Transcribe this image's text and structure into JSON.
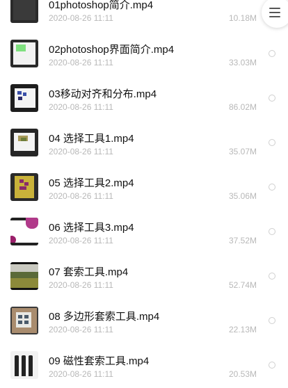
{
  "files": [
    {
      "name": "01photoshop简介.mp4",
      "date": "2020-08-26 11:11",
      "size": "10.18M",
      "icon": "video-thumbnail-dark"
    },
    {
      "name": "02photoshop界面简介.mp4",
      "date": "2020-08-26 11:11",
      "size": "33.03M",
      "icon": "video-thumbnail-interface"
    },
    {
      "name": "03移动对齐和分布.mp4",
      "date": "2020-08-26 11:11",
      "size": "86.02M",
      "icon": "video-thumbnail-align"
    },
    {
      "name": "04 选择工具1.mp4",
      "date": "2020-08-26 11:11",
      "size": "35.07M",
      "icon": "video-thumbnail-select1"
    },
    {
      "name": "05 选择工具2.mp4",
      "date": "2020-08-26 11:11",
      "size": "35.06M",
      "icon": "video-thumbnail-select2"
    },
    {
      "name": "06 选择工具3.mp4",
      "date": "2020-08-26 11:11",
      "size": "37.52M",
      "icon": "video-thumbnail-select3"
    },
    {
      "name": "07 套索工具.mp4",
      "date": "2020-08-26 11:11",
      "size": "52.74M",
      "icon": "video-thumbnail-landscape"
    },
    {
      "name": "08 多边形套索工具.mp4",
      "date": "2020-08-26 11:11",
      "size": "22.13M",
      "icon": "video-thumbnail-building"
    },
    {
      "name": "09 磁性套索工具.mp4",
      "date": "2020-08-26 11:11",
      "size": "20.53M",
      "icon": "video-thumbnail-bottles"
    }
  ],
  "menu_icon": "hamburger-menu-icon"
}
